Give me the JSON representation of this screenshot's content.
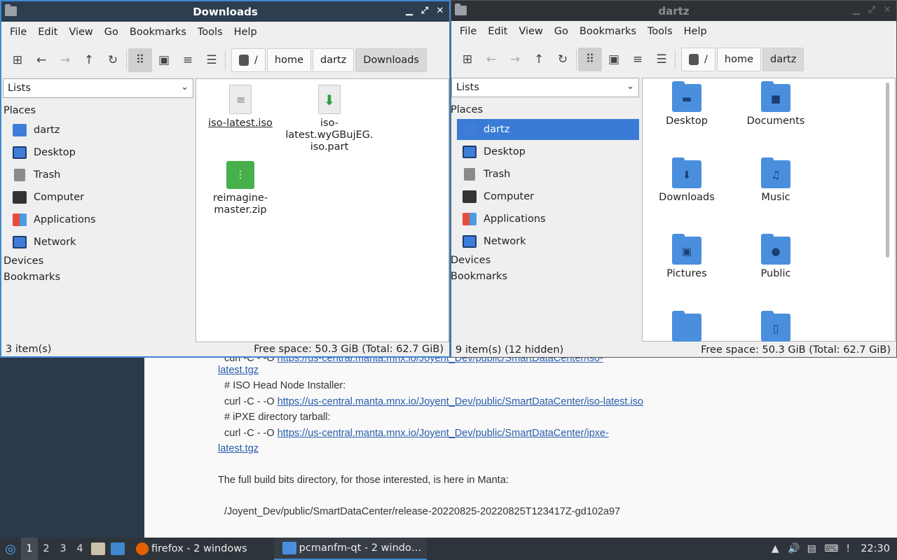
{
  "browser": {
    "lines": [
      {
        "text": "curl -C - -O ",
        "link": "https://us-central.manta.mnx.io/Joyent_Dev/public/SmartDataCenter/iso-"
      },
      {
        "text": "",
        "link": "latest.tgz"
      },
      {
        "text": "# ISO Head Node Installer:",
        "link": ""
      },
      {
        "text": "curl -C - -O ",
        "link": "https://us-central.manta.mnx.io/Joyent_Dev/public/SmartDataCenter/iso-latest.iso"
      },
      {
        "text": "# iPXE directory tarball:",
        "link": ""
      },
      {
        "text": "curl -C - -O ",
        "link": "https://us-central.manta.mnx.io/Joyent_Dev/public/SmartDataCenter/ipxe-"
      },
      {
        "text": "",
        "link": "latest.tgz"
      },
      {
        "text": "The full build bits directory, for those interested, is here in Manta:",
        "link": ""
      },
      {
        "text": "/Joyent_Dev/public/SmartDataCenter/release-20220825-20220825T123417Z-gd102a97",
        "link": ""
      }
    ]
  },
  "menu": [
    "File",
    "Edit",
    "View",
    "Go",
    "Bookmarks",
    "Tools",
    "Help"
  ],
  "sidebar": {
    "combo": "Lists",
    "places_header": "Places",
    "places": [
      "dartz",
      "Desktop",
      "Trash",
      "Computer",
      "Applications",
      "Network"
    ],
    "devices_header": "Devices",
    "bookmarks_header": "Bookmarks"
  },
  "left_window": {
    "title": "Downloads",
    "crumbs": [
      "/",
      "home",
      "dartz",
      "Downloads"
    ],
    "files": [
      {
        "name": "iso-latest.iso",
        "icon": "document-icon"
      },
      {
        "name": "iso-\nlatest.wyGBujEG.\niso.part",
        "icon": "partial-download-icon"
      },
      {
        "name": "reimagine-\nmaster.zip",
        "icon": "zip-archive-icon"
      }
    ],
    "status_items": "3 item(s)",
    "status_space": "Free space: 50.3 GiB (Total: 62.7 GiB)"
  },
  "right_window": {
    "title": "dartz",
    "crumbs": [
      "/",
      "home",
      "dartz"
    ],
    "files": [
      {
        "name": "Desktop",
        "glyph": "▬"
      },
      {
        "name": "Documents",
        "glyph": "■"
      },
      {
        "name": "Downloads",
        "glyph": "⬇"
      },
      {
        "name": "Music",
        "glyph": "♫"
      },
      {
        "name": "Pictures",
        "glyph": "▣"
      },
      {
        "name": "Public",
        "glyph": "●"
      },
      {
        "name": "",
        "glyph": ""
      },
      {
        "name": "",
        "glyph": "▯"
      }
    ],
    "status_items": "9 item(s) (12 hidden)",
    "status_space": "Free space: 50.3 GiB (Total: 62.7 GiB)"
  },
  "taskbar": {
    "workspaces": [
      "1",
      "2",
      "3",
      "4"
    ],
    "firefox": "firefox - 2 windows",
    "pcmanfm": "pcmanfm-qt - 2 windo…",
    "clock": "22:30"
  }
}
